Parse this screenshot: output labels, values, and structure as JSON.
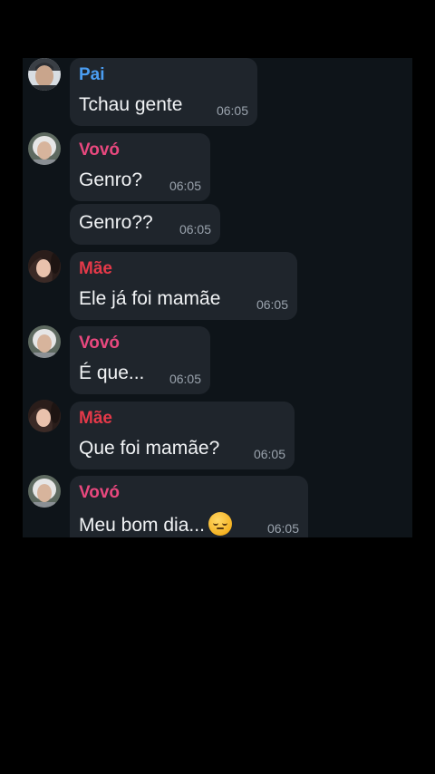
{
  "colors": {
    "pai": "#4a9df2",
    "vovo": "#e8487e",
    "mae": "#e53949"
  },
  "messages": [
    {
      "sender": "Pai",
      "text": "Tchau gente",
      "time": "06:05"
    },
    {
      "sender": "Vovó",
      "text": "Genro?",
      "time": "06:05"
    },
    {
      "sender": "",
      "text": "Genro??",
      "time": "06:05"
    },
    {
      "sender": "Mãe",
      "text": "Ele já foi mamãe",
      "time": "06:05"
    },
    {
      "sender": "Vovó",
      "text": "É que...",
      "time": "06:05"
    },
    {
      "sender": "Mãe",
      "text": "Que foi mamãe?",
      "time": "06:05"
    },
    {
      "sender": "Vovó",
      "text": "Meu bom dia...",
      "emoji": "pensive-face-emoji",
      "time": "06:05"
    }
  ]
}
